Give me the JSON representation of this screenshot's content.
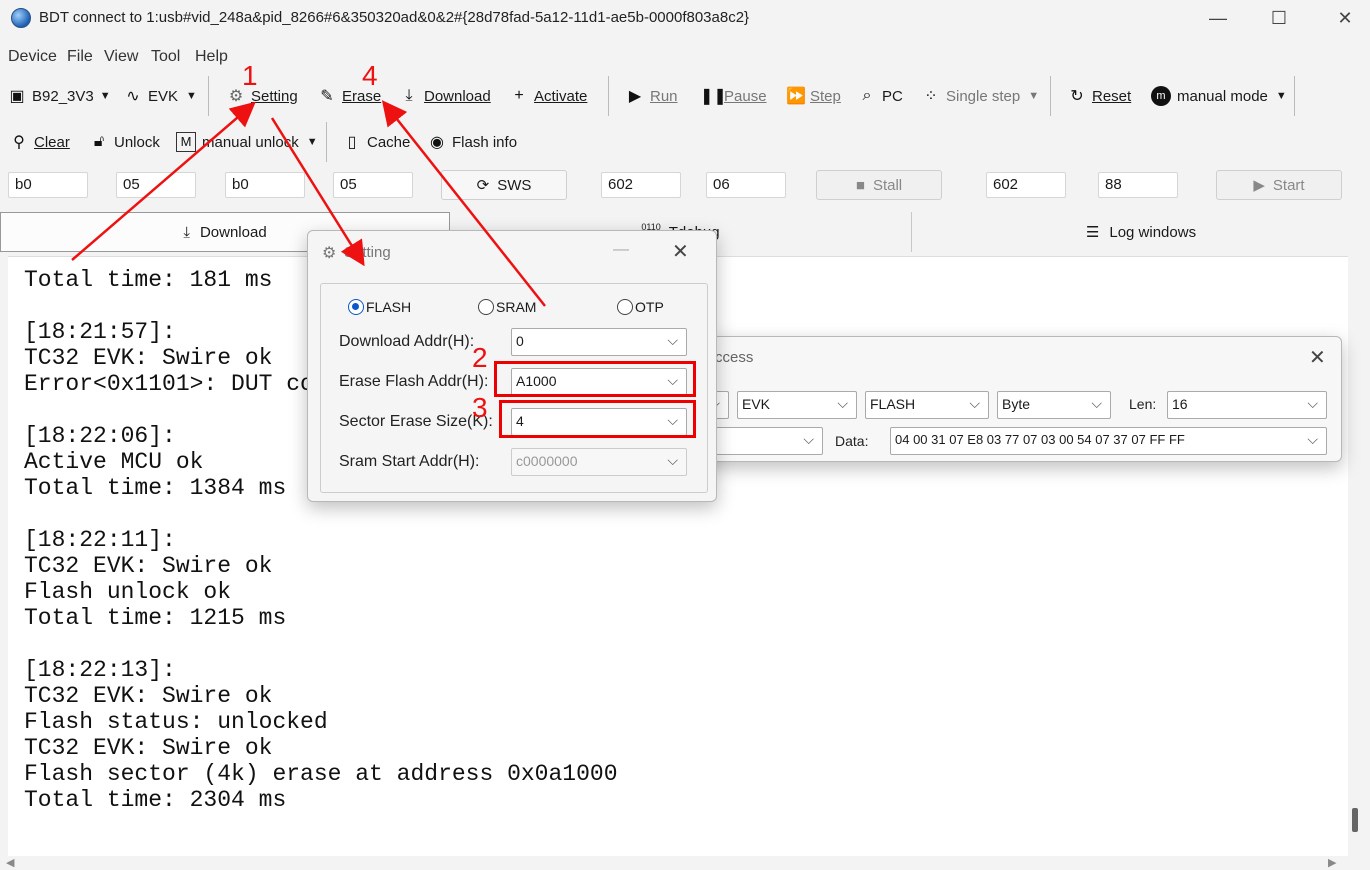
{
  "window": {
    "title": "BDT connect to 1:usb#vid_248a&pid_8266#6&350320ad&0&2#{28d78fad-5a12-11d1-ae5b-0000f803a8c2}",
    "minimize": "—",
    "maximize": "☐",
    "close": "✕"
  },
  "menu": [
    "Device",
    "File",
    "View",
    "Tool",
    "Help"
  ],
  "toolbar1": {
    "chip": "B92_3V3",
    "board": "EVK",
    "setting": "Setting",
    "erase": "Erase",
    "download": "Download",
    "activate": "Activate",
    "run": "Run",
    "pause": "Pause",
    "step": "Step",
    "pc": "PC",
    "single_step": "Single step",
    "reset": "Reset",
    "mode": "manual mode"
  },
  "toolbar2": {
    "clear": "Clear",
    "unlock": "Unlock",
    "manual_unlock": "manual unlock",
    "cache": "Cache",
    "flash_info": "Flash info"
  },
  "regs": {
    "f1": "b0",
    "f2": "05",
    "f3": "b0",
    "f4": "05",
    "sws": "SWS",
    "f5": "602",
    "f6": "06",
    "stall": "Stall",
    "f7": "602",
    "f8": "88",
    "start": "Start"
  },
  "tabs": {
    "download": "Download",
    "tdebug": "Tdebug",
    "log": "Log windows"
  },
  "log_text": "Total time: 181 ms\n\n[18:21:57]:\nTC32 EVK: Swire ok\nError<0x1101>: DUT co\n\n[18:22:06]:\nActive MCU ok\nTotal time: 1384 ms\n\n[18:22:11]:\nTC32 EVK: Swire ok\nFlash unlock ok\nTotal time: 1215 ms\n\n[18:22:13]:\nTC32 EVK: Swire ok\nFlash status: unlocked\nTC32 EVK: Swire ok\nFlash sector (4k) erase at address 0x0a1000\nTotal time: 2304 ms",
  "access_dialog": {
    "title": "ccess",
    "board": "EVK",
    "target": "FLASH",
    "unit": "Byte",
    "len_label": "Len:",
    "len": "16",
    "data_label": "Data:",
    "data": "04 00 31 07 E8 03 77 07 03 00 54 07 37 07 FF FF"
  },
  "setting_dialog": {
    "title": "Setting",
    "radio_flash": "FLASH",
    "radio_sram": "SRAM",
    "radio_otp": "OTP",
    "selected": "FLASH",
    "download_addr_label": "Download  Addr(H):",
    "download_addr": "0",
    "erase_addr_label": "Erase Flash Addr(H):",
    "erase_addr": "A1000",
    "sector_size_label": "Sector Erase Size(K):",
    "sector_size": "4",
    "sram_start_label": "Sram Start Addr(H):",
    "sram_start": "c0000000"
  },
  "annotations": {
    "n1": "1",
    "n2": "2",
    "n3": "3",
    "n4": "4",
    "color": "#ee1111"
  }
}
